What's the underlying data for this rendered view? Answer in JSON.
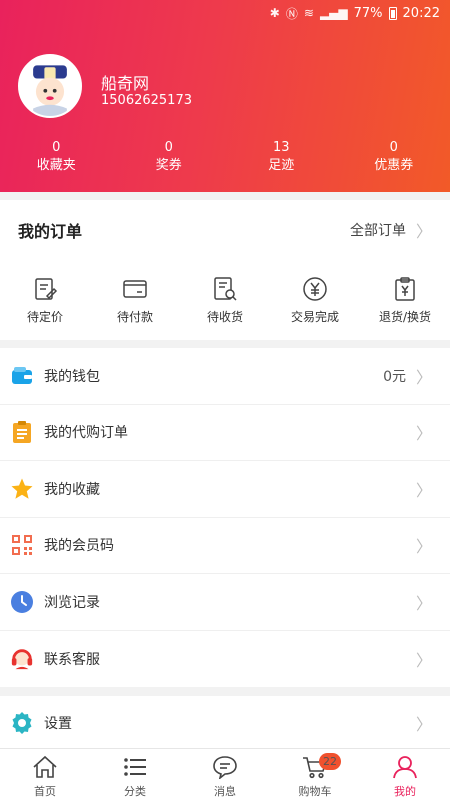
{
  "status_bar": {
    "battery": "77%",
    "time": "20:22"
  },
  "profile": {
    "name": "船奇网",
    "phone": "15062625173"
  },
  "stats": [
    {
      "value": "0",
      "label": "收藏夹"
    },
    {
      "value": "0",
      "label": "奖券"
    },
    {
      "value": "13",
      "label": "足迹"
    },
    {
      "value": "0",
      "label": "优惠券"
    }
  ],
  "orders": {
    "title": "我的订单",
    "all_label": "全部订单",
    "items": [
      {
        "label": "待定价",
        "icon": "pricing-icon"
      },
      {
        "label": "待付款",
        "icon": "wallet-card-icon"
      },
      {
        "label": "待收货",
        "icon": "receipt-search-icon"
      },
      {
        "label": "交易完成",
        "icon": "yuan-circle-icon"
      },
      {
        "label": "退货/换货",
        "icon": "return-clipboard-icon"
      }
    ]
  },
  "menu": [
    {
      "label": "我的钱包",
      "value": "0元",
      "icon": "wallet-icon"
    },
    {
      "label": "我的代购订单",
      "value": "",
      "icon": "clipboard-icon"
    },
    {
      "label": "我的收藏",
      "value": "",
      "icon": "star-icon"
    },
    {
      "label": "我的会员码",
      "value": "",
      "icon": "qr-code-icon"
    },
    {
      "label": "浏览记录",
      "value": "",
      "icon": "clock-icon"
    },
    {
      "label": "联系客服",
      "value": "",
      "icon": "headset-icon"
    }
  ],
  "settings": {
    "label": "设置",
    "icon": "gear-icon"
  },
  "tabbar": [
    {
      "label": "首页",
      "icon": "home-icon"
    },
    {
      "label": "分类",
      "icon": "list-icon"
    },
    {
      "label": "消息",
      "icon": "message-icon"
    },
    {
      "label": "购物车",
      "icon": "cart-icon",
      "badge": "22"
    },
    {
      "label": "我的",
      "icon": "user-icon",
      "active": true
    }
  ],
  "colors": {
    "accent": "#e9225c",
    "gradient_end": "#f25a28",
    "badge": "#f0512e"
  }
}
